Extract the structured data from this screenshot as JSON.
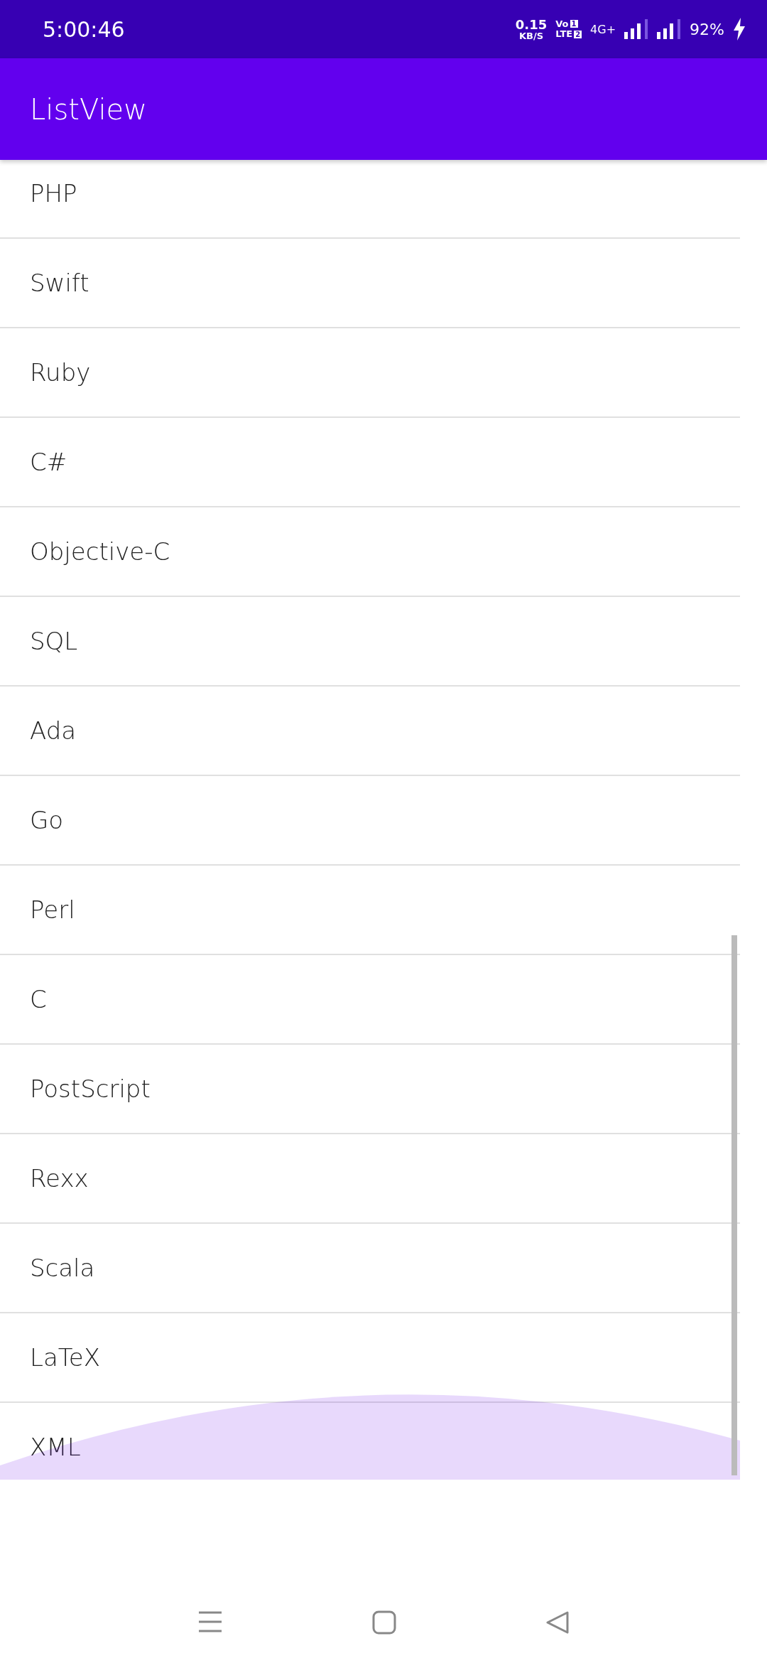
{
  "status_bar": {
    "time": "5:00:46",
    "speed_value": "0.15",
    "speed_unit": "KB/S",
    "volte_top": "Vo",
    "sim_one": "1",
    "volte_bottom": "LTE",
    "sim_two": "2",
    "network_type": "4G+",
    "battery": "92%",
    "charging": true
  },
  "app_bar": {
    "title": "ListView"
  },
  "list": {
    "items": [
      "PHP",
      "Swift",
      "Ruby",
      "C#",
      "Objective-C",
      "SQL",
      "Ada",
      "Go",
      "Perl",
      "C",
      "PostScript",
      "Rexx",
      "Scala",
      "LaTeX",
      "XML"
    ]
  }
}
